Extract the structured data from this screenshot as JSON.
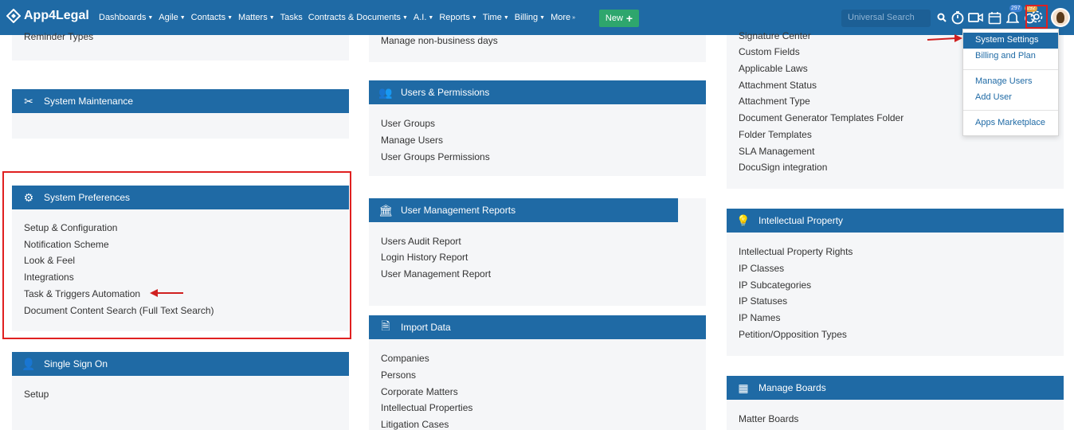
{
  "topbar": {
    "brand": "App4Legal",
    "nav": [
      "Dashboards",
      "Agile",
      "Contacts",
      "Matters",
      "Tasks",
      "Contracts & Documents",
      "A.I.",
      "Reports",
      "Time",
      "Billing",
      "More"
    ],
    "new_label": "New",
    "search_placeholder": "Universal Search",
    "badge_notifications": "297",
    "badge_reminders": "192"
  },
  "left": {
    "reminder_types": "Reminder Types",
    "system_maintenance": "System Maintenance",
    "system_preferences": {
      "title": "System Preferences",
      "items": [
        "Setup & Configuration",
        "Notification Scheme",
        "Look & Feel",
        "Integrations",
        "Task & Triggers Automation",
        "Document Content Search (Full Text Search)"
      ]
    },
    "single_sign_on": {
      "title": "Single Sign On",
      "items": [
        "Setup"
      ]
    }
  },
  "middle": {
    "non_business": "Manage non-business days",
    "users_permissions": {
      "title": "Users & Permissions",
      "items": [
        "User Groups",
        "Manage Users",
        "User Groups Permissions"
      ]
    },
    "user_mgmt_reports": {
      "title": "User Management Reports",
      "items": [
        "Users Audit Report",
        "Login History Report",
        "User Management Report"
      ]
    },
    "import_data": {
      "title": "Import Data",
      "items": [
        "Companies",
        "Persons",
        "Corporate Matters",
        "Intellectual Properties",
        "Litigation Cases"
      ]
    }
  },
  "right": {
    "top_items": [
      "Signature Center",
      "Custom Fields",
      "Applicable Laws",
      "Attachment Status",
      "Attachment Type",
      "Document Generator Templates Folder",
      "Folder Templates",
      "SLA Management",
      "DocuSign integration"
    ],
    "ip": {
      "title": "Intellectual Property",
      "items": [
        "Intellectual Property Rights",
        "IP Classes",
        "IP Subcategories",
        "IP Statuses",
        "IP Names",
        "Petition/Opposition Types"
      ]
    },
    "boards": {
      "title": "Manage Boards",
      "items": [
        "Matter Boards"
      ]
    }
  },
  "dropdown": {
    "items": [
      "System Settings",
      "Billing and Plan",
      "Manage Users",
      "Add User",
      "Apps Marketplace"
    ]
  },
  "colors": {
    "header": "#1f6aa5",
    "accent_red": "#e02020",
    "new_button": "#2ea66d"
  }
}
